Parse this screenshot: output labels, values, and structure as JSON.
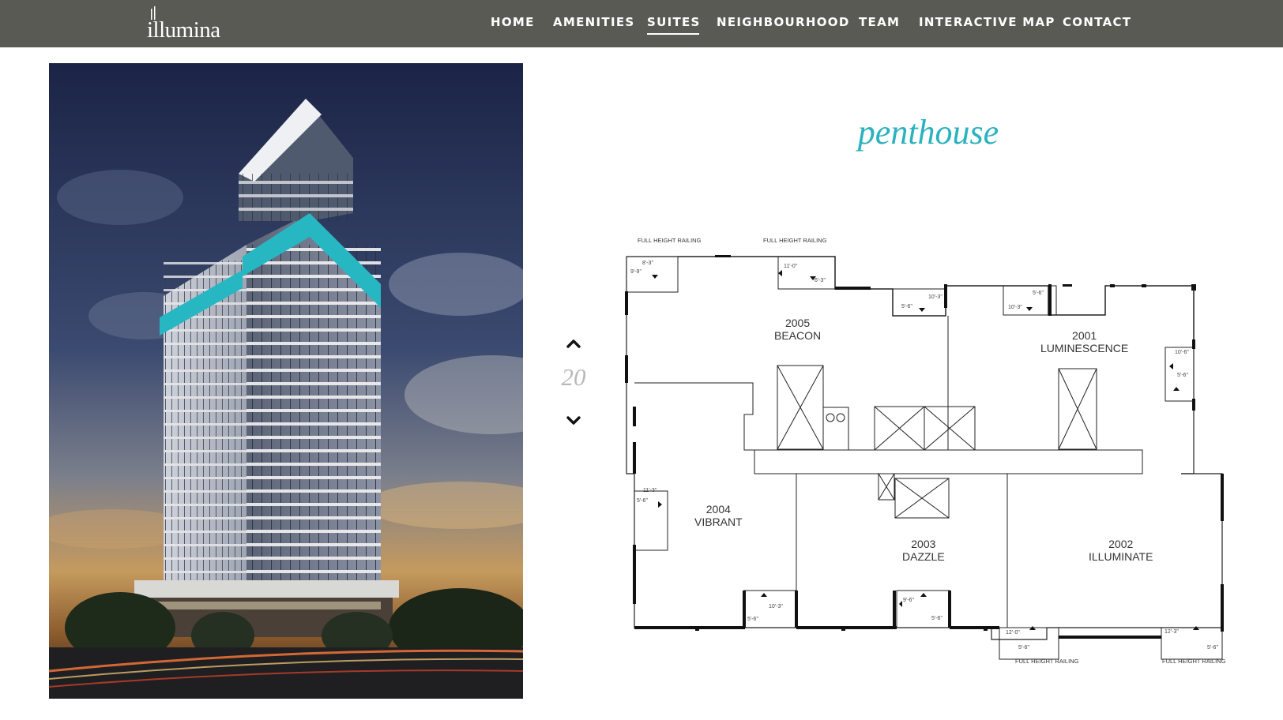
{
  "logo": {
    "text": "illumina"
  },
  "nav": {
    "items": [
      {
        "label": "HOME",
        "active": false
      },
      {
        "label": "AMENITIES",
        "active": false
      },
      {
        "label": "SUITES",
        "active": true
      },
      {
        "label": "NEIGHBOURHOOD",
        "active": false
      },
      {
        "label": "TEAM",
        "active": false
      },
      {
        "label": "INTERACTIVE MAP",
        "active": false
      },
      {
        "label": "CONTACT",
        "active": false
      }
    ]
  },
  "suite_title": "penthouse",
  "floor": {
    "number": "20"
  },
  "floor_plan": {
    "railing_top_left": "FULL HEIGHT RAILING",
    "railing_top_right": "FULL HEIGHT RAILING",
    "railing_bottom_left": "FULL HEIGHT RAILING",
    "railing_bottom_right": "FULL HEIGHT RAILING",
    "units": [
      {
        "number": "2005",
        "name": "BEACON"
      },
      {
        "number": "2001",
        "name": "LUMINESCENCE"
      },
      {
        "number": "2004",
        "name": "VIBRANT"
      },
      {
        "number": "2003",
        "name": "DAZZLE"
      },
      {
        "number": "2002",
        "name": "ILLUMINATE"
      }
    ],
    "dimensions": {
      "d1": "8'-3\"",
      "d2": "9'-9\"",
      "d3": "11'-0\"",
      "d4": "6'-3\"",
      "d5": "10'-3\"",
      "d6": "5'-6\"",
      "d7": "5'-6\"",
      "d8": "10'-3\"",
      "d9": "10'-6\"",
      "d10": "5'-6\"",
      "d11": "11'-3\"",
      "d12": "5'-6\"",
      "d13": "10'-3\"",
      "d14": "5'-6\"",
      "d15": "9'-6\"",
      "d16": "5'-6\"",
      "d17": "12'-0\"",
      "d18": "5'-6\"",
      "d19": "12'-3\"",
      "d20": "5'-6\""
    }
  },
  "colors": {
    "accent": "#2ab2bf",
    "navbar": "#5a5a55"
  },
  "icons": {
    "up": "chevron-up-icon",
    "down": "chevron-down-icon"
  }
}
